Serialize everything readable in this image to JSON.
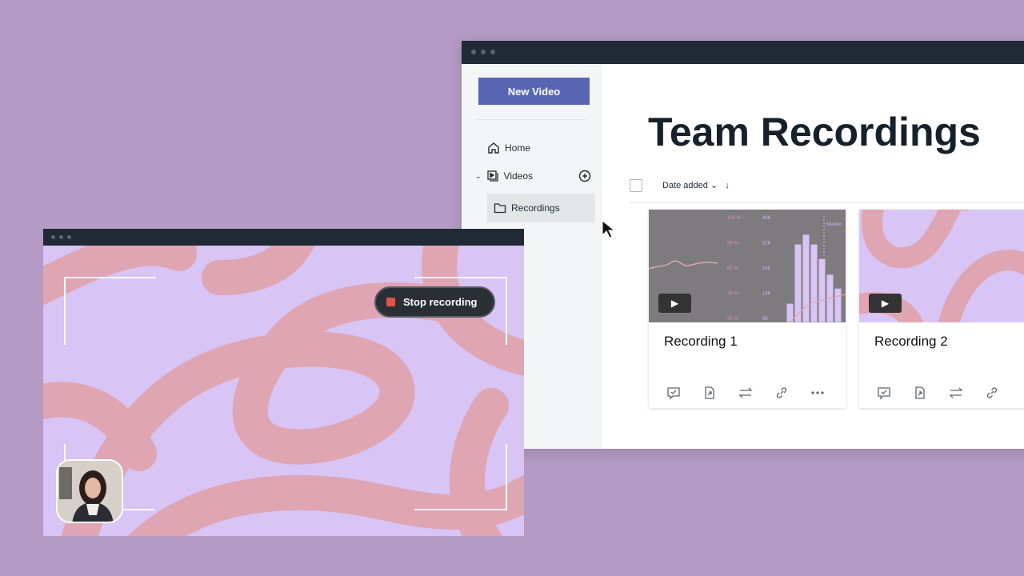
{
  "colors": {
    "background": "#b49ac4",
    "accent": "#5865b5",
    "titlebar": "#1f2a36",
    "lavender": "#d8c4f5",
    "pink": "#dfa5b3",
    "stop": "#e05545"
  },
  "app": {
    "sidebar": {
      "new_video": "New Video",
      "items": [
        {
          "label": "Home",
          "icon": "home-icon"
        },
        {
          "label": "Videos",
          "icon": "video-library-icon"
        },
        {
          "label": "Recordings",
          "icon": "folder-icon"
        }
      ]
    },
    "title": "Team Recordings",
    "sort": {
      "label": "Date added ⌄",
      "direction": "↓"
    },
    "cards": [
      {
        "title": "Recording 1",
        "thumb": {
          "left_ticks": [
            "100 %",
            "80 %",
            "60 %",
            "40 %",
            "20 %"
          ],
          "right_ticks": [
            "40K",
            "32K",
            "24K",
            "16K",
            "8K"
          ],
          "marker": "Median",
          "bars_k": [
            12.8,
            31.6,
            34.7,
            31.6,
            27,
            22,
            17.6
          ]
        }
      },
      {
        "title": "Recording 2"
      }
    ],
    "actions": [
      "comment-icon",
      "share-file-icon",
      "swap-icon",
      "link-icon",
      "more-icon"
    ]
  },
  "recorder": {
    "stop_label": "Stop recording"
  }
}
